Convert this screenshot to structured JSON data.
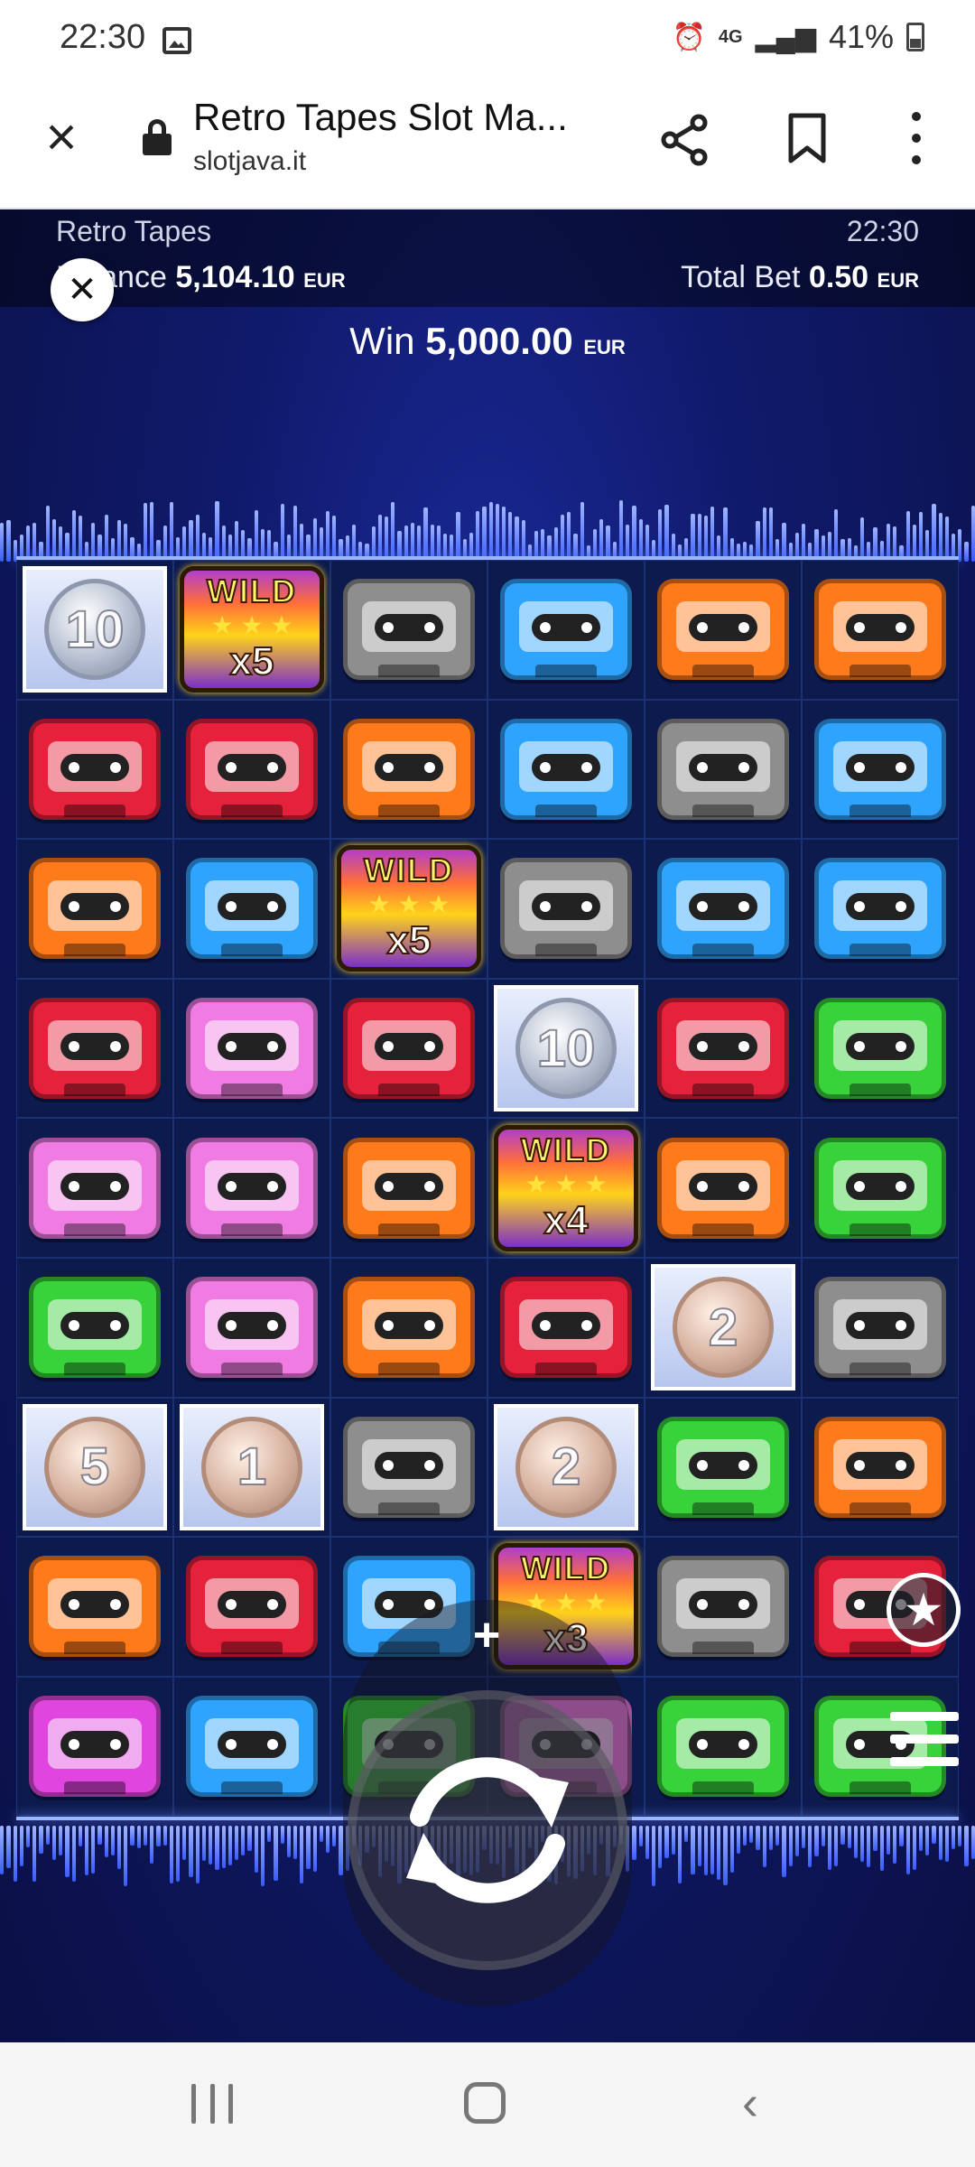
{
  "status_bar": {
    "time": "22:30",
    "network": "4G",
    "battery": "41%"
  },
  "browser": {
    "title": "Retro Tapes Slot Ma...",
    "domain": "slotjava.it"
  },
  "game": {
    "name": "Retro Tapes",
    "clock": "22:30",
    "balance_label": "Balance",
    "balance_value": "5,104.10",
    "currency": "EUR",
    "total_bet_label": "Total Bet",
    "total_bet_value": "0.50",
    "win_label": "Win",
    "win_value": "5,000.00"
  },
  "grid": {
    "rows": [
      [
        {
          "t": "coin",
          "metal": "silver",
          "v": "10"
        },
        {
          "t": "wild",
          "label": "WILD",
          "mult": "x5"
        },
        {
          "t": "tape",
          "c": "gray"
        },
        {
          "t": "tape",
          "c": "blue"
        },
        {
          "t": "tape",
          "c": "orange"
        },
        {
          "t": "tape",
          "c": "orange"
        }
      ],
      [
        {
          "t": "tape",
          "c": "red"
        },
        {
          "t": "tape",
          "c": "red"
        },
        {
          "t": "tape",
          "c": "orange"
        },
        {
          "t": "tape",
          "c": "blue"
        },
        {
          "t": "tape",
          "c": "gray"
        },
        {
          "t": "tape",
          "c": "blue"
        }
      ],
      [
        {
          "t": "tape",
          "c": "orange"
        },
        {
          "t": "tape",
          "c": "blue"
        },
        {
          "t": "wild",
          "label": "WILD",
          "mult": "x5"
        },
        {
          "t": "tape",
          "c": "gray"
        },
        {
          "t": "tape",
          "c": "blue"
        },
        {
          "t": "tape",
          "c": "blue"
        }
      ],
      [
        {
          "t": "tape",
          "c": "red"
        },
        {
          "t": "tape",
          "c": "pink"
        },
        {
          "t": "tape",
          "c": "red"
        },
        {
          "t": "coin",
          "metal": "silver",
          "v": "10"
        },
        {
          "t": "tape",
          "c": "red"
        },
        {
          "t": "tape",
          "c": "green"
        }
      ],
      [
        {
          "t": "tape",
          "c": "pink"
        },
        {
          "t": "tape",
          "c": "pink"
        },
        {
          "t": "tape",
          "c": "orange"
        },
        {
          "t": "wild",
          "label": "WILD",
          "mult": "x4"
        },
        {
          "t": "tape",
          "c": "orange"
        },
        {
          "t": "tape",
          "c": "green"
        }
      ],
      [
        {
          "t": "tape",
          "c": "green"
        },
        {
          "t": "tape",
          "c": "pink"
        },
        {
          "t": "tape",
          "c": "orange"
        },
        {
          "t": "tape",
          "c": "red"
        },
        {
          "t": "coin",
          "metal": "bronze",
          "v": "2"
        },
        {
          "t": "tape",
          "c": "gray"
        }
      ],
      [
        {
          "t": "coin",
          "metal": "bronze",
          "v": "5"
        },
        {
          "t": "coin",
          "metal": "bronze",
          "v": "1"
        },
        {
          "t": "tape",
          "c": "gray"
        },
        {
          "t": "coin",
          "metal": "bronze",
          "v": "2"
        },
        {
          "t": "tape",
          "c": "green"
        },
        {
          "t": "tape",
          "c": "orange"
        }
      ],
      [
        {
          "t": "tape",
          "c": "orange"
        },
        {
          "t": "tape",
          "c": "red"
        },
        {
          "t": "tape",
          "c": "blue"
        },
        {
          "t": "wild",
          "label": "WILD",
          "mult": "x3"
        },
        {
          "t": "tape",
          "c": "gray"
        },
        {
          "t": "tape",
          "c": "red"
        }
      ],
      [
        {
          "t": "tape",
          "c": "magenta"
        },
        {
          "t": "tape",
          "c": "blue"
        },
        {
          "t": "tape",
          "c": "green"
        },
        {
          "t": "tape",
          "c": "pink"
        },
        {
          "t": "tape",
          "c": "green"
        },
        {
          "t": "tape",
          "c": "green"
        }
      ]
    ]
  },
  "controls": {
    "plus_symbol": "+",
    "favorite_symbol": "★",
    "close_symbol": "✕"
  },
  "colors": {
    "game_background": "#101a6b",
    "accent": "#9ab6ff"
  }
}
